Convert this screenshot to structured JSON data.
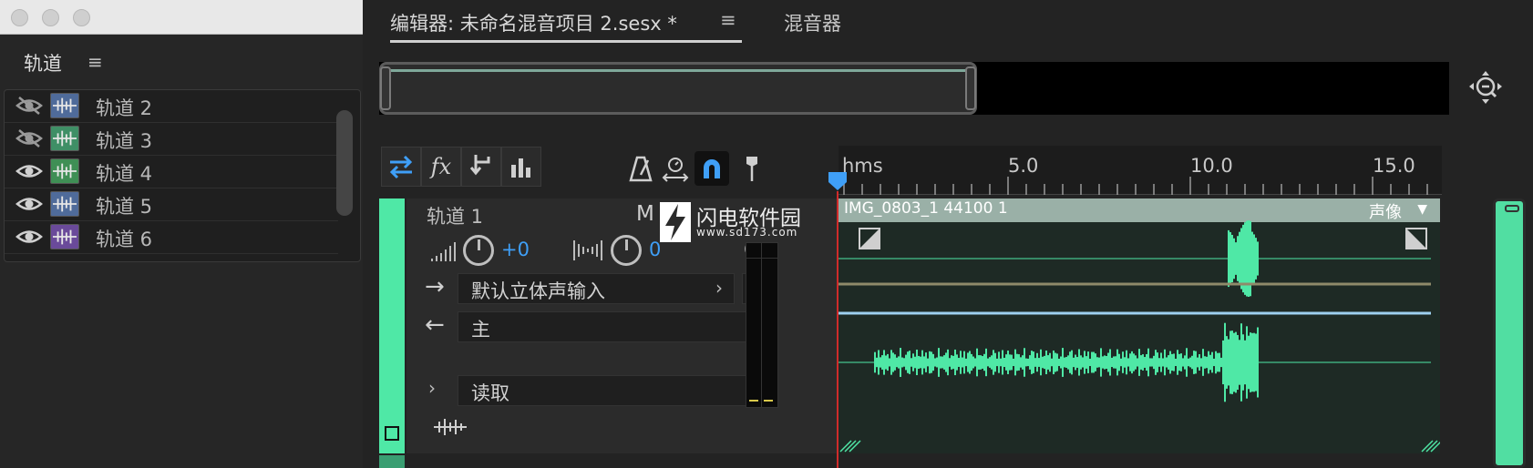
{
  "tracks_panel": {
    "title": "轨道",
    "tracks": [
      {
        "name": "轨道 2",
        "visible": false,
        "color": "#4f6b9a"
      },
      {
        "name": "轨道 3",
        "visible": false,
        "color": "#3f8f66"
      },
      {
        "name": "轨道 4",
        "visible": true,
        "color": "#3f8f55"
      },
      {
        "name": "轨道 5",
        "visible": true,
        "color": "#4f6b9a"
      },
      {
        "name": "轨道 6",
        "visible": true,
        "color": "#6a4a9a"
      }
    ]
  },
  "tabs": {
    "editor": "编辑器: 未命名混音项目 2.sesx *",
    "mixer": "混音器"
  },
  "ruler": {
    "unit": "hms",
    "labels": [
      "5.0",
      "10.0",
      "15.0"
    ]
  },
  "track1": {
    "name": "轨道 1",
    "volume": "+0",
    "pan": "0",
    "input": "默认立体声输入",
    "output": "主",
    "automation": "读取",
    "color": "#4fe8a6"
  },
  "clip": {
    "name": "IMG_0803_1 44100 1",
    "mode": "声像",
    "color": "#4fe8a6"
  },
  "watermark": {
    "main": "闪电软件园",
    "sub": "www.sd173.com",
    "prefix": "M"
  },
  "colors": {
    "accent": "#3f9ff7",
    "waveform": "#4fe8a6",
    "playhead": "#d02b2b"
  }
}
